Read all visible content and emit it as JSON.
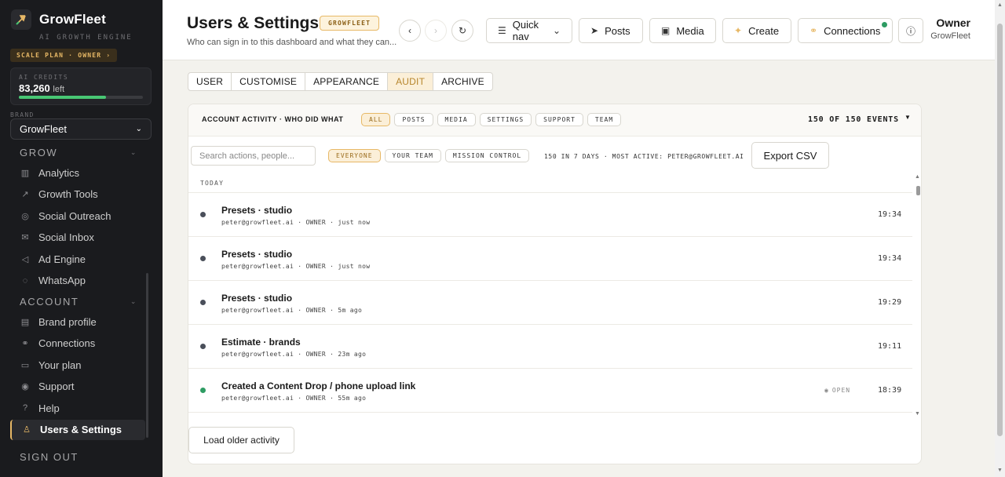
{
  "app": {
    "name": "GrowFleet",
    "tagline": "AI GROWTH ENGINE",
    "plan_badge": "SCALE PLAN · OWNER ›",
    "credits_label": "AI CREDITS",
    "credits_value": "83,260",
    "credits_suffix": "left",
    "credits_fraction": 0.7,
    "brand_label": "BRAND",
    "brand_selected": "GrowFleet",
    "accent_color": "#e7b866",
    "sidebar_bg": "#1a1b1e"
  },
  "sidebar": {
    "grow_label": "GROW",
    "grow_items": [
      {
        "label": "Analytics",
        "icon": "bar-chart-icon"
      },
      {
        "label": "Growth Tools",
        "icon": "trend-up-icon"
      },
      {
        "label": "Social Outreach",
        "icon": "target-icon"
      },
      {
        "label": "Social Inbox",
        "icon": "mail-icon"
      },
      {
        "label": "Ad Engine",
        "icon": "megaphone-icon"
      },
      {
        "label": "WhatsApp",
        "icon": "whatsapp-icon"
      }
    ],
    "account_label": "ACCOUNT",
    "account_items": [
      {
        "label": "Brand profile",
        "icon": "id-card-icon"
      },
      {
        "label": "Connections",
        "icon": "link-icon"
      },
      {
        "label": "Your plan",
        "icon": "credit-card-icon"
      },
      {
        "label": "Support",
        "icon": "lifebuoy-icon"
      },
      {
        "label": "Help",
        "icon": "question-icon"
      },
      {
        "label": "Users & Settings",
        "icon": "users-icon"
      }
    ],
    "signout": "SIGN OUT"
  },
  "header": {
    "title": "Users & Settings",
    "title_badge": "GROWFLEET",
    "subtitle": "Who can sign in to this dashboard and what they can...",
    "quick_nav": "Quick nav",
    "posts": "Posts",
    "media": "Media",
    "create": "Create",
    "connections": "Connections",
    "owner_name": "Owner",
    "owner_org": "GrowFleet"
  },
  "tabs": [
    "USER",
    "CUSTOMISE",
    "APPEARANCE",
    "AUDIT",
    "ARCHIVE"
  ],
  "active_tab": "AUDIT",
  "activity": {
    "title": "ACCOUNT ACTIVITY · WHO DID WHAT",
    "filters": [
      "ALL",
      "POSTS",
      "MEDIA",
      "SETTINGS",
      "SUPPORT",
      "TEAM"
    ],
    "active_filter": "ALL",
    "count_text": "150 OF 150 EVENTS",
    "search_placeholder": "Search actions, people...",
    "scope_filters": [
      "EVERYONE",
      "YOUR TEAM",
      "MISSION CONTROL"
    ],
    "active_scope": "EVERYONE",
    "stats": "150 IN 7 DAYS · MOST ACTIVE: PETER@GROWFLEET.AI",
    "export_label": "Export CSV",
    "day_label": "TODAY",
    "rows": [
      {
        "title": "Presets · studio",
        "meta": "peter@growfleet.ai · OWNER · just now",
        "time": "19:34",
        "status": "default"
      },
      {
        "title": "Presets · studio",
        "meta": "peter@growfleet.ai · OWNER · just now",
        "time": "19:34",
        "status": "default"
      },
      {
        "title": "Presets · studio",
        "meta": "peter@growfleet.ai · OWNER · 5m ago",
        "time": "19:29",
        "status": "default"
      },
      {
        "title": "Estimate · brands",
        "meta": "peter@growfleet.ai · OWNER · 23m ago",
        "time": "19:11",
        "status": "default"
      },
      {
        "title": "Created a Content Drop / phone upload link",
        "meta": "peter@growfleet.ai · OWNER · 55m ago",
        "time": "18:39",
        "status": "success",
        "action": "OPEN"
      }
    ],
    "load_older": "Load older activity"
  }
}
